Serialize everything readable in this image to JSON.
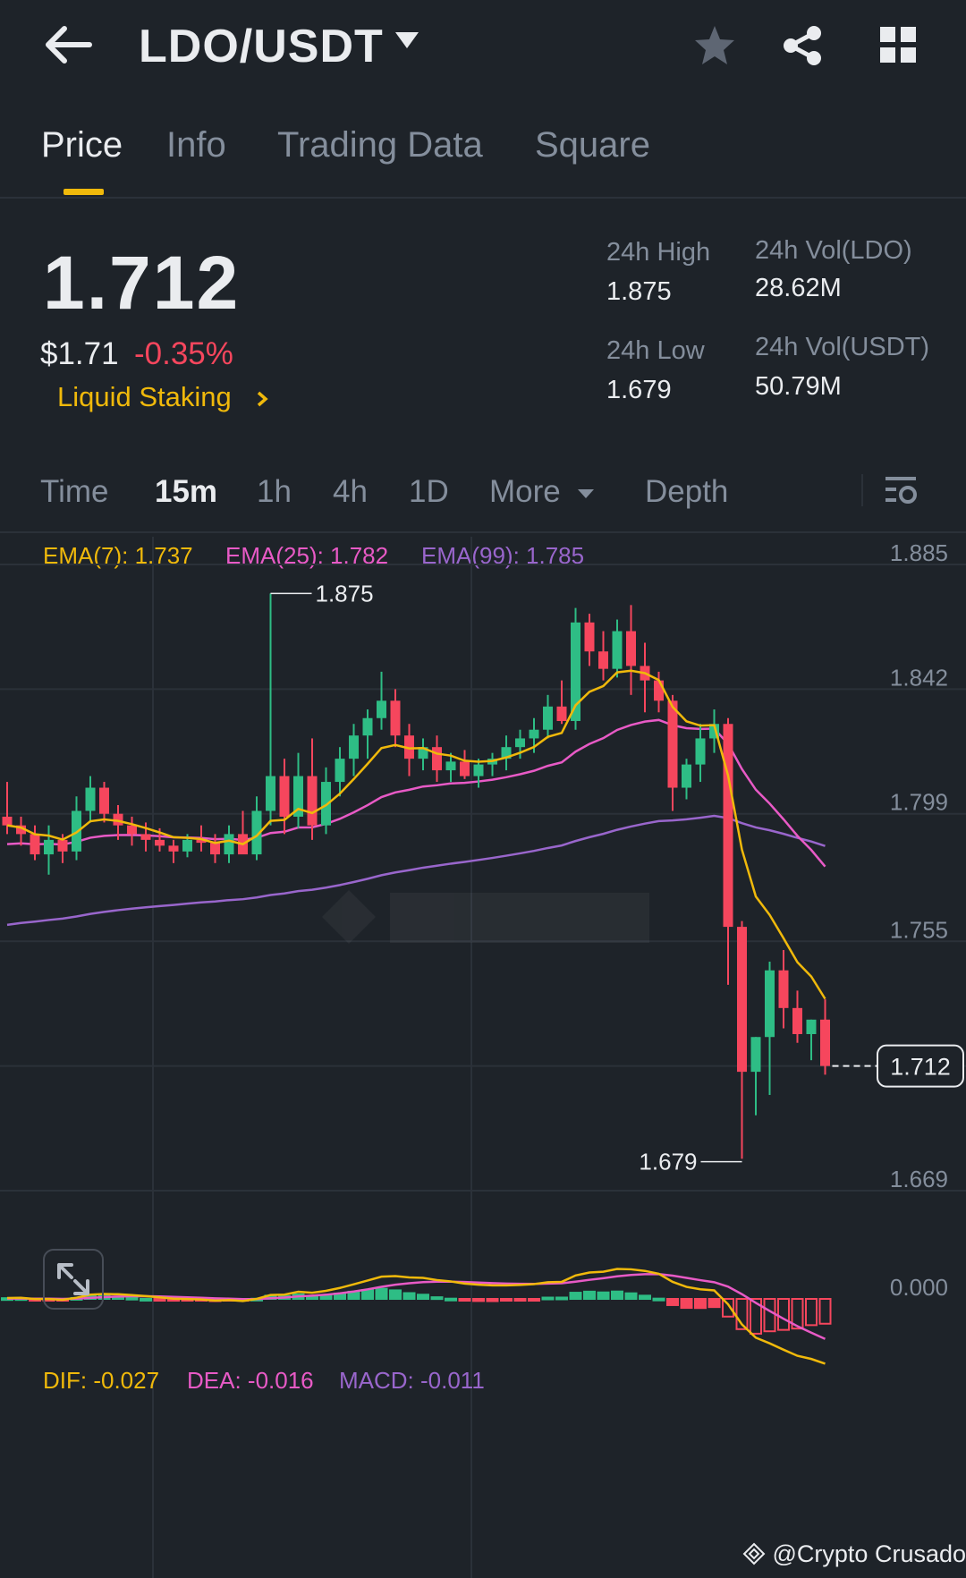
{
  "header": {
    "pair": "LDO/USDT",
    "icons": [
      "back-arrow-icon",
      "caret-down-icon",
      "star-icon",
      "share-icon",
      "grid-icon"
    ]
  },
  "tabs": [
    {
      "label": "Price",
      "active": true
    },
    {
      "label": "Info",
      "active": false
    },
    {
      "label": "Trading Data",
      "active": false
    },
    {
      "label": "Square",
      "active": false
    }
  ],
  "price": {
    "last": "1.712",
    "usd": "$1.71",
    "change": "-0.35%",
    "tag": "Liquid Staking"
  },
  "stats": {
    "high_label": "24h High",
    "high_value": "1.875",
    "low_label": "24h Low",
    "low_value": "1.679",
    "vol_base_label": "24h Vol(LDO)",
    "vol_base_value": "28.62M",
    "vol_quote_label": "24h Vol(USDT)",
    "vol_quote_value": "50.79M"
  },
  "intervals": {
    "time": "Time",
    "items": [
      "15m",
      "1h",
      "4h",
      "1D"
    ],
    "active": "15m",
    "more": "More",
    "depth": "Depth"
  },
  "indicators": {
    "ema7": "EMA(7): 1.737",
    "ema25": "EMA(25): 1.782",
    "ema99": "EMA(99): 1.785",
    "dif": "DIF: -0.027",
    "dea": "DEA: -0.016",
    "macd": "MACD: -0.011"
  },
  "colors": {
    "up": "#2ebd85",
    "down": "#f6465d",
    "ema7": "#f0b90b",
    "ema25": "#e85ac6",
    "ema99": "#9966cc",
    "accent": "#f0b90b"
  },
  "chart_data": {
    "type": "candlestick",
    "y_ticks": [
      "1.885",
      "1.842",
      "1.799",
      "1.755",
      "1.712",
      "1.669"
    ],
    "ylim": [
      1.669,
      1.885
    ],
    "high_marker": "1.875",
    "low_marker": "1.679",
    "last_price_label": "1.712",
    "candles": [
      [
        1.798,
        1.81,
        1.792,
        1.795
      ],
      [
        1.795,
        1.798,
        1.788,
        1.792
      ],
      [
        1.792,
        1.795,
        1.783,
        1.785
      ],
      [
        1.785,
        1.795,
        1.778,
        1.79
      ],
      [
        1.79,
        1.792,
        1.782,
        1.786
      ],
      [
        1.786,
        1.805,
        1.783,
        1.8
      ],
      [
        1.8,
        1.812,
        1.796,
        1.808
      ],
      [
        1.808,
        1.81,
        1.796,
        1.799
      ],
      [
        1.799,
        1.802,
        1.79,
        1.795
      ],
      [
        1.795,
        1.798,
        1.788,
        1.792
      ],
      [
        1.792,
        1.796,
        1.786,
        1.79
      ],
      [
        1.79,
        1.794,
        1.786,
        1.788
      ],
      [
        1.788,
        1.79,
        1.782,
        1.786
      ],
      [
        1.786,
        1.792,
        1.784,
        1.79
      ],
      [
        1.79,
        1.795,
        1.786,
        1.789
      ],
      [
        1.789,
        1.792,
        1.782,
        1.785
      ],
      [
        1.785,
        1.795,
        1.782,
        1.792
      ],
      [
        1.792,
        1.8,
        1.786,
        1.785
      ],
      [
        1.785,
        1.805,
        1.783,
        1.8
      ],
      [
        1.8,
        1.875,
        1.795,
        1.812
      ],
      [
        1.812,
        1.818,
        1.792,
        1.798
      ],
      [
        1.798,
        1.82,
        1.794,
        1.812
      ],
      [
        1.812,
        1.825,
        1.79,
        1.795
      ],
      [
        1.795,
        1.815,
        1.792,
        1.81
      ],
      [
        1.81,
        1.822,
        1.805,
        1.818
      ],
      [
        1.818,
        1.83,
        1.812,
        1.826
      ],
      [
        1.826,
        1.835,
        1.818,
        1.832
      ],
      [
        1.832,
        1.848,
        1.828,
        1.838
      ],
      [
        1.838,
        1.842,
        1.822,
        1.826
      ],
      [
        1.826,
        1.83,
        1.812,
        1.818
      ],
      [
        1.818,
        1.825,
        1.814,
        1.822
      ],
      [
        1.822,
        1.826,
        1.81,
        1.814
      ],
      [
        1.814,
        1.82,
        1.81,
        1.817
      ],
      [
        1.817,
        1.821,
        1.811,
        1.812
      ],
      [
        1.812,
        1.818,
        1.808,
        1.816
      ],
      [
        1.816,
        1.82,
        1.812,
        1.818
      ],
      [
        1.818,
        1.826,
        1.814,
        1.822
      ],
      [
        1.822,
        1.828,
        1.818,
        1.825
      ],
      [
        1.825,
        1.832,
        1.82,
        1.828
      ],
      [
        1.828,
        1.84,
        1.825,
        1.836
      ],
      [
        1.836,
        1.845,
        1.83,
        1.831
      ],
      [
        1.831,
        1.87,
        1.828,
        1.865
      ],
      [
        1.865,
        1.868,
        1.85,
        1.855
      ],
      [
        1.855,
        1.862,
        1.845,
        1.849
      ],
      [
        1.849,
        1.866,
        1.846,
        1.862
      ],
      [
        1.862,
        1.871,
        1.84,
        1.85
      ],
      [
        1.85,
        1.858,
        1.834,
        1.845
      ],
      [
        1.845,
        1.848,
        1.834,
        1.838
      ],
      [
        1.838,
        1.84,
        1.8,
        1.808
      ],
      [
        1.808,
        1.818,
        1.804,
        1.816
      ],
      [
        1.816,
        1.83,
        1.81,
        1.825
      ],
      [
        1.825,
        1.835,
        1.82,
        1.83
      ],
      [
        1.83,
        1.832,
        1.74,
        1.76
      ],
      [
        1.76,
        1.762,
        1.68,
        1.71
      ],
      [
        1.71,
        1.722,
        1.695,
        1.722
      ],
      [
        1.722,
        1.748,
        1.702,
        1.745
      ],
      [
        1.745,
        1.752,
        1.725,
        1.732
      ],
      [
        1.732,
        1.738,
        1.72,
        1.723
      ],
      [
        1.723,
        1.728,
        1.714,
        1.728
      ],
      [
        1.728,
        1.735,
        1.709,
        1.712
      ]
    ]
  }
}
